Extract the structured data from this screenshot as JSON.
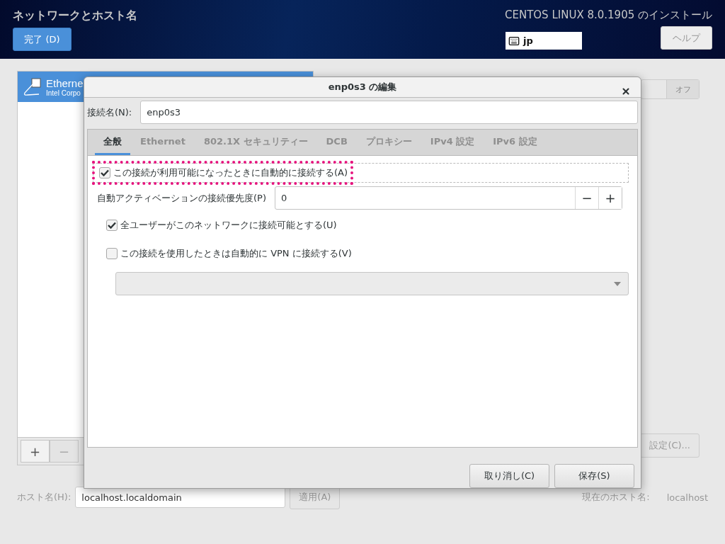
{
  "header": {
    "title": "ネットワークとホスト名",
    "done_button": "完了 (D)",
    "product_title": "CENTOS LINUX 8.0.1905 のインストール",
    "keyboard_layout": "jp",
    "help_button": "ヘルプ"
  },
  "connections": {
    "items": [
      {
        "name": "Etherne",
        "detail": "Intel Corpo",
        "selected": true
      }
    ],
    "add_button": "+",
    "remove_button": "−",
    "remove_disabled": true
  },
  "device": {
    "toggle": "オフ",
    "on": false,
    "settings_button": "設定(C)..."
  },
  "hostname": {
    "label": "ホスト名(H):",
    "value": "localhost.localdomain",
    "apply_button": "適用(A)",
    "current_label": "現在のホスト名:",
    "current_value": "localhost"
  },
  "dialog": {
    "title": "enp0s3 の編集",
    "name_label": "接続名(N):",
    "name_value": "enp0s3",
    "tabs": [
      {
        "label": "全般",
        "selected": true
      },
      {
        "label": "Ethernet",
        "selected": false
      },
      {
        "label": "802.1X セキュリティー",
        "selected": false
      },
      {
        "label": "DCB",
        "selected": false
      },
      {
        "label": "プロキシー",
        "selected": false
      },
      {
        "label": "IPv4 設定",
        "selected": false
      },
      {
        "label": "IPv6 設定",
        "selected": false
      }
    ],
    "options": [
      {
        "kind": "checkbox",
        "label": "この接続が利用可能になったときに自動的に接続する(A)",
        "checked": true,
        "focused": true,
        "highlighted": true
      },
      {
        "kind": "spin",
        "label": "自動アクティベーションの接続優先度(P)",
        "value": "0",
        "minus": "−",
        "plus": "+"
      },
      {
        "kind": "checkbox",
        "label": "全ユーザーがこのネットワークに接続可能とする(U)",
        "checked": true,
        "focused": false,
        "highlighted": false
      },
      {
        "kind": "checkbox",
        "label": "この接続を使用したときは自動的に VPN に接続する(V)",
        "checked": false,
        "focused": false,
        "highlighted": false
      },
      {
        "kind": "select",
        "disabled": true
      }
    ],
    "buttons": [
      "取り消し(C)",
      "保存(S)"
    ]
  }
}
